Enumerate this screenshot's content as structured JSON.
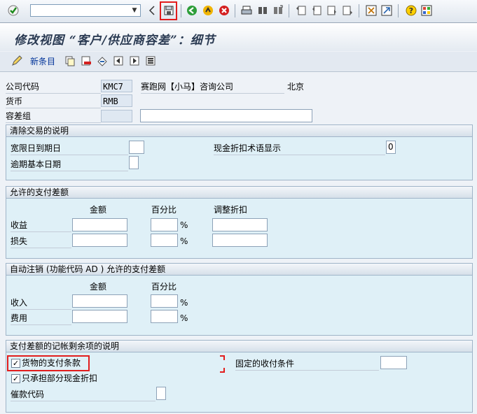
{
  "toolbar": {
    "command_field": {
      "value": "",
      "placeholder": ""
    },
    "icons": [
      "enter-icon",
      "back-triangle-icon",
      "save-icon",
      "back-icon",
      "exit-icon",
      "cancel-icon",
      "print-icon",
      "find-icon",
      "find-next-icon",
      "first-page-icon",
      "previous-page-icon",
      "next-page-icon",
      "last-page-icon",
      "create-session-icon",
      "shortcut-icon",
      "help-icon",
      "layout-icon"
    ]
  },
  "title": "修改视图 “客户/供应商容差”：细节",
  "app_toolbar": {
    "new_entries_label": "新条目"
  },
  "header": {
    "company_code_label": "公司代码",
    "company_code_value": "KMC7",
    "company_name": "赛跑网【小马】咨询公司",
    "city": "北京",
    "currency_label": "货币",
    "currency_value": "RMB",
    "tolerance_group_label": "容差组",
    "tolerance_group_value": "",
    "tolerance_group_desc": ""
  },
  "groups": {
    "clearing": {
      "title": "清除交易的说明",
      "grace_days_label": "宽限日到期日",
      "grace_days_value": "",
      "cash_discount_label": "现金折扣术语显示",
      "cash_discount_value": "0",
      "arrears_base_label": "逾期基本日期",
      "arrears_base_value": ""
    },
    "permitted": {
      "title": "允许的支付差额",
      "col_amount": "金额",
      "col_percent": "百分比",
      "col_adjust": "调整折扣",
      "row_gain": "收益",
      "row_loss": "损失",
      "pct": "%"
    },
    "auto_writeoff": {
      "title": "自动注销 (功能代码 AD ) 允许的支付差额",
      "col_amount": "金额",
      "col_percent": "百分比",
      "row_revenue": "收入",
      "row_expense": "费用",
      "pct": "%"
    },
    "residual": {
      "title": "支付差额的记帐剩余项的说明",
      "goods_terms_label": "货物的支付条款",
      "goods_terms_checked": true,
      "fixed_terms_label": "固定的收付条件",
      "fixed_terms_value": "",
      "partial_discount_label": "只承担部分现金折扣",
      "partial_discount_checked": true,
      "dunning_key_label": "催款代码",
      "dunning_key_value": ""
    }
  },
  "colors": {
    "highlight": "#e21d1d",
    "group_bg": "#dff0f7",
    "link": "#003399"
  }
}
